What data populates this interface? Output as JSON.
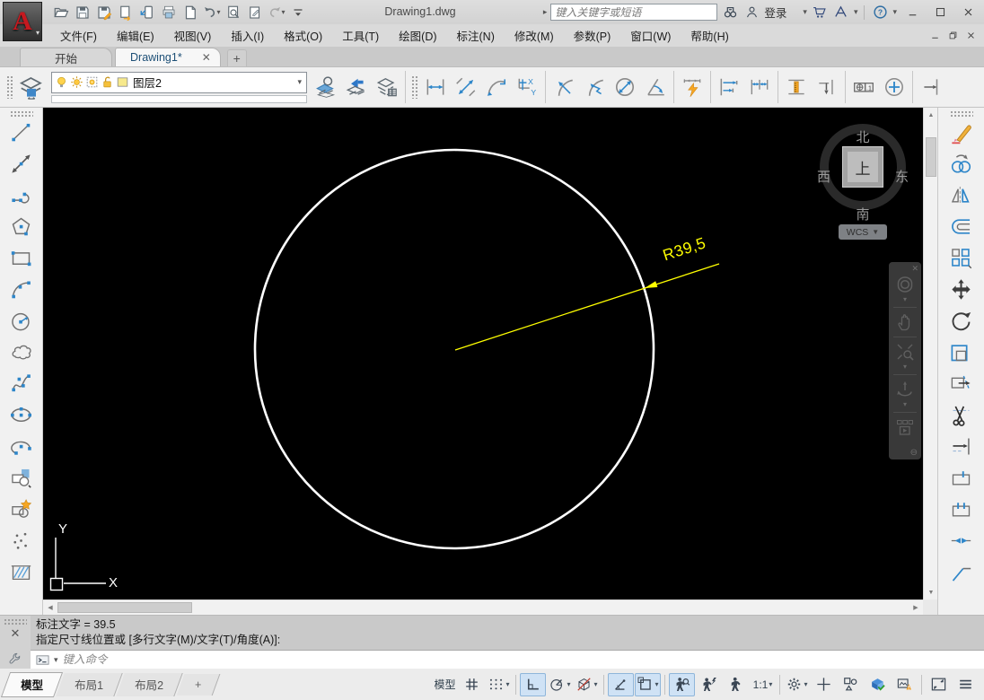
{
  "titlebar": {
    "app_button": "A",
    "document_title": "Drawing1.dwg",
    "search_placeholder": "键入关键字或短语",
    "signin_label": "登录",
    "qat": [
      {
        "icon": "open"
      },
      {
        "icon": "save"
      },
      {
        "icon": "save-as"
      },
      {
        "icon": "export"
      },
      {
        "icon": "mobile-upload"
      },
      {
        "icon": "print"
      },
      {
        "icon": "new"
      },
      {
        "icon": "undo",
        "caret": true
      },
      {
        "icon": "preview"
      },
      {
        "icon": "sketch"
      },
      {
        "icon": "redo",
        "caret": true,
        "disabled": true
      },
      {
        "icon": "toolbar-overflow"
      }
    ],
    "right_icons": [
      "binoculars",
      "user",
      "cart",
      "a360",
      "help"
    ],
    "window_buttons": [
      "minimize",
      "maximize",
      "close"
    ]
  },
  "menubar": {
    "items": [
      "文件(F)",
      "编辑(E)",
      "视图(V)",
      "插入(I)",
      "格式(O)",
      "工具(T)",
      "绘图(D)",
      "标注(N)",
      "修改(M)",
      "参数(P)",
      "窗口(W)",
      "帮助(H)"
    ],
    "window_buttons": [
      "minimize",
      "restore",
      "close"
    ]
  },
  "file_tabs": {
    "tabs": [
      {
        "label": "开始",
        "active": false,
        "closable": false
      },
      {
        "label": "Drawing1*",
        "active": true,
        "closable": true
      }
    ],
    "new_tab": "+"
  },
  "ribbon_toolbar": {
    "layers_panel_icon": "layers-panel",
    "layer_combo": {
      "value": "图层2",
      "state_icons": [
        "bulb",
        "sun",
        "freeze-frame",
        "unlock",
        "swatch"
      ]
    },
    "layer_tools": [
      "make-current",
      "layer-previous",
      "layer-properties"
    ],
    "dimension_groups": [
      [
        "dim-linear",
        "dim-aligned",
        "dim-arc-length",
        "dim-ordinate"
      ],
      [
        "dim-radius",
        "dim-jogged",
        "dim-diameter",
        "dim-angular"
      ],
      [
        "quick-dim"
      ],
      [
        "dim-baseline",
        "dim-continue"
      ],
      [
        "dim-space",
        "dim-break"
      ],
      [
        "tolerance",
        "center-mark"
      ],
      [
        "dim-edit"
      ]
    ]
  },
  "draw_toolbar": [
    "line",
    "construction-line",
    "polyline",
    "polygon",
    "rectangle",
    "arc",
    "circle",
    "revision-cloud",
    "spline",
    "ellipse",
    "ellipse-arc",
    "insert-block",
    "create-block",
    "point",
    "hatch"
  ],
  "modify_toolbar": [
    "erase",
    "copy",
    "mirror",
    "offset",
    "array",
    "move",
    "rotate",
    "scale",
    "stretch",
    "trim",
    "extend",
    "break-at-point",
    "break",
    "join",
    "chamfer"
  ],
  "canvas": {
    "background": "#000000",
    "circle": {
      "color": "#ffffff"
    },
    "dimension": {
      "label": "R39,5",
      "value": 39.5,
      "color": "#ffff00"
    },
    "ucs": {
      "x_label": "X",
      "y_label": "Y"
    },
    "viewcube": {
      "north": "北",
      "south": "南",
      "east": "东",
      "west": "西",
      "top": "上",
      "wcs_label": "WCS"
    },
    "navigation_bar": [
      {
        "icon": "nav-wheel",
        "caret": true
      },
      {
        "icon": "pan-hand"
      },
      {
        "icon": "nav-zoom",
        "caret": true
      },
      {
        "icon": "orbit",
        "caret": true
      },
      {
        "icon": "showmotion"
      }
    ]
  },
  "command_panel": {
    "history": [
      "标注文字 = 39.5",
      "指定尺寸线位置或 [多行文字(M)/文字(T)/角度(A)]:"
    ],
    "input_placeholder": "键入命令"
  },
  "layout_tabs": [
    {
      "label": "模型",
      "active": true
    },
    {
      "label": "布局1",
      "active": false
    },
    {
      "label": "布局2",
      "active": false
    },
    {
      "label": "+",
      "active": false,
      "plus": true
    }
  ],
  "status_bar": {
    "tools": [
      {
        "name": "model-space",
        "label": "模型"
      },
      {
        "name": "grid-display",
        "icon": "grid"
      },
      {
        "name": "snap-mode",
        "icon": "snap-grid",
        "caret": true
      },
      {
        "sep": true
      },
      {
        "name": "ortho-mode",
        "icon": "ortho",
        "active": true
      },
      {
        "name": "polar-tracking",
        "icon": "polar",
        "caret": true
      },
      {
        "name": "isometric-drafting",
        "icon": "iso",
        "caret": true
      },
      {
        "sep": true
      },
      {
        "name": "object-snap-tracking",
        "icon": "otrack",
        "active": true
      },
      {
        "name": "object-snap",
        "icon": "osnap",
        "active": true,
        "caret": true
      },
      {
        "sep": true
      },
      {
        "name": "annotation-visibility",
        "icon": "ann-visibility",
        "active": true
      },
      {
        "name": "auto-annotation-scale",
        "icon": "ann-autoscale"
      },
      {
        "name": "annotation-scale-flyout",
        "icon": "ann-scale"
      },
      {
        "name": "annotation-scale",
        "label": "1:1",
        "caret": true
      },
      {
        "sep": true
      },
      {
        "name": "workspace-switching",
        "icon": "gear",
        "caret": true
      },
      {
        "name": "crosshair-toggle",
        "icon": "crosshair"
      },
      {
        "name": "isolate-objects",
        "icon": "isolate"
      },
      {
        "name": "hardware-acceleration",
        "icon": "hw-accel"
      },
      {
        "name": "graphics-performance",
        "icon": "gfx-warning"
      },
      {
        "sep": true
      },
      {
        "name": "clean-screen",
        "icon": "fullscreen"
      },
      {
        "name": "customization",
        "icon": "customize"
      }
    ]
  },
  "colors": {
    "accent_blue": "#2e86c9",
    "dimension_yellow": "#ffff00",
    "canvas_black": "#000000",
    "highlight_bg": "#cfe2f5"
  }
}
